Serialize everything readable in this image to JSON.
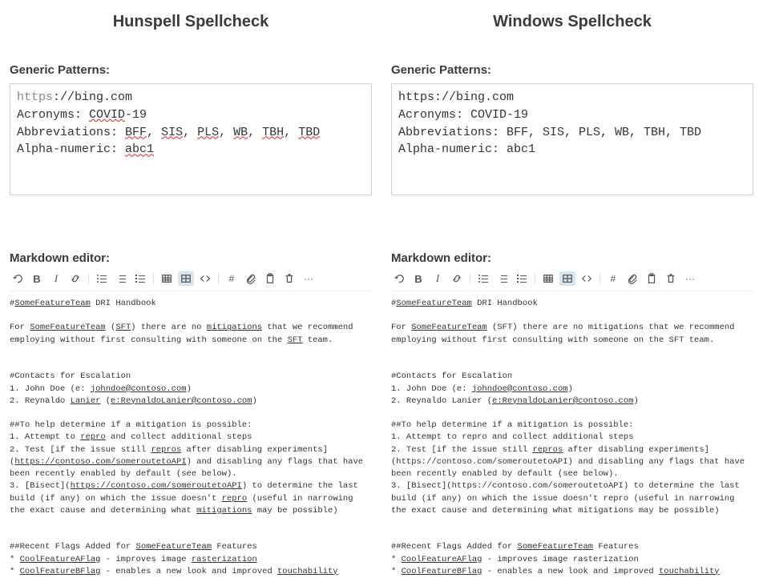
{
  "left": {
    "title": "Hunspell Spellcheck",
    "patterns_label": "Generic Patterns:",
    "markdown_label": "Markdown editor:",
    "toolbar": {
      "undo": "↩",
      "bold": "B",
      "italic": "I",
      "link": "⧉",
      "hash": "#",
      "clip": "📎",
      "copy": "⎘",
      "trash": "🗑",
      "more": "···"
    },
    "gp": {
      "url_proto": "https",
      "url_rest": "://bing.com",
      "acronyms_pre": "Acronyms: ",
      "covid": "COVID",
      "covid_suffix": "-19",
      "abbrev_pre": "Abbreviations: ",
      "bff": "BFF",
      "sis": "SIS",
      "pls": "PLS",
      "wb": "WB",
      "tbh": "TBH",
      "tbd": "TBD",
      "alpha_pre": "Alpha-numeric: ",
      "abc1": "abc1"
    },
    "md": {
      "l1_pre": "#",
      "l1_sft": "SomeFeatureTeam",
      "l1_post": " DRI Handbook",
      "l2_pre": "For ",
      "l2_sft": "SomeFeatureTeam",
      "l2_mid1": " (",
      "l2_sftabbr": "SFT",
      "l2_mid2": ") there are no ",
      "l2_mit": "mitigations",
      "l2_tail": " that we recommend employing without first consulting with someone on the ",
      "l2_sftabbr2": "SFT",
      "l2_end": " team.",
      "c_head": "#Contacts for Escalation",
      "c1_pre": "1. John Doe (e: ",
      "c1_mail": "johndoe@contoso.com",
      "c1_post": ")",
      "c2_pre": "2. Reynaldo ",
      "c2_lanier": "Lanier",
      "c2_mid": " (",
      "c2_mail": "e:ReynaldoLanier@contoso.com",
      "c2_post": ")",
      "h_head": "##To help determine if a mitigation is possible:",
      "h1_pre": "1. Attempt to ",
      "h1_repro": "repro",
      "h1_post": " and collect additional steps",
      "h2_pre": "2. Test [if the issue still ",
      "h2_repros": "repros",
      "h2_mid": " after disabling experiments](",
      "h2_url": "https://contoso.com/someroutetoAPI",
      "h2_tail": ") and disabling any flags that have been recently enabled by default (see below).",
      "h3_pre": "3. [Bisect](",
      "h3_url": "https://contoso.com/someroutetoAPI",
      "h3_mid": ") to determine the last build (if any) on which the issue doesn't ",
      "h3_repro": "repro",
      "h3_mid2": " (useful in narrowing the exact cause and determining what ",
      "h3_mit": "mitigations",
      "h3_end": " may be possible)",
      "f_head_pre": "##Recent Flags Added for ",
      "f_head_sft": "SomeFeatureTeam",
      "f_head_post": " Features",
      "f1_pre": "* ",
      "f1_flag": "CoolFeatureAFlag",
      "f1_mid": " - improves image ",
      "f1_rast": "rasterization",
      "f2_pre": "* ",
      "f2_flag": "CoolFeatureBFlag",
      "f2_mid": " - enables a new look and improved ",
      "f2_touch": "touchability"
    }
  },
  "right": {
    "title": "Windows Spellcheck",
    "patterns_label": "Generic Patterns:",
    "markdown_label": "Markdown editor:",
    "gp": {
      "l1": "https://bing.com",
      "l2": "Acronyms: COVID-19",
      "l3": "Abbreviations: BFF, SIS, PLS, WB, TBH, TBD",
      "l4": "Alpha-numeric: abc1"
    },
    "md": {
      "l1_pre": "#",
      "l1_sft": "SomeFeatureTeam",
      "l1_post": " DRI Handbook",
      "l2_pre": "For ",
      "l2_sft": "SomeFeatureTeam",
      "l2_tail": " (SFT) there are no mitigations that we recommend employing without first consulting with someone on the SFT team.",
      "c_head": "#Contacts for Escalation",
      "c1_pre": "1. John Doe (e: ",
      "c1_mail": "johndoe@contoso.com",
      "c1_post": ")",
      "c2_pre": "2. Reynaldo Lanier (",
      "c2_mail": "e:ReynaldoLanier@contoso.com",
      "c2_post": ")",
      "h_head": "##To help determine if a mitigation is possible:",
      "h1": "1. Attempt to repro and collect additional steps",
      "h2_pre": "2. Test [if the issue still ",
      "h2_repros": "repros",
      "h2_tail": " after disabling experiments](https://contoso.com/someroutetoAPI) and disabling any flags that have been recently enabled by default (see below).",
      "h3": "3. [Bisect](https://contoso.com/someroutetoAPI) to determine the last build (if any) on which the issue doesn't repro (useful in narrowing the exact cause and determining what mitigations may be possible)",
      "f_head_pre": "##Recent Flags Added for ",
      "f_head_sft": "SomeFeatureTeam",
      "f_head_post": " Features",
      "f1_pre": "* ",
      "f1_flag": "CoolFeatureAFlag",
      "f1_mid": " - improves image rasterization",
      "f2_pre": "* ",
      "f2_flag": "CoolFeatureBFlag",
      "f2_mid": " - enables a new look and improved ",
      "f2_touch": "touchability"
    }
  }
}
